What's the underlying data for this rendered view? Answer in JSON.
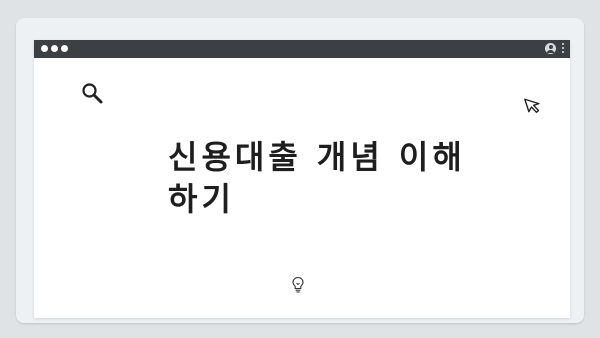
{
  "page": {
    "title": "신용대출 개념 이해하기"
  },
  "window": {
    "titlebar_color": "#3c3f43",
    "background_color": "#ffffff"
  },
  "icons": {
    "search": "search-icon",
    "cursor": "cursor-arrow-icon",
    "bulb": "lightbulb-icon",
    "user": "user-icon",
    "menu": "kebab-menu-icon"
  }
}
